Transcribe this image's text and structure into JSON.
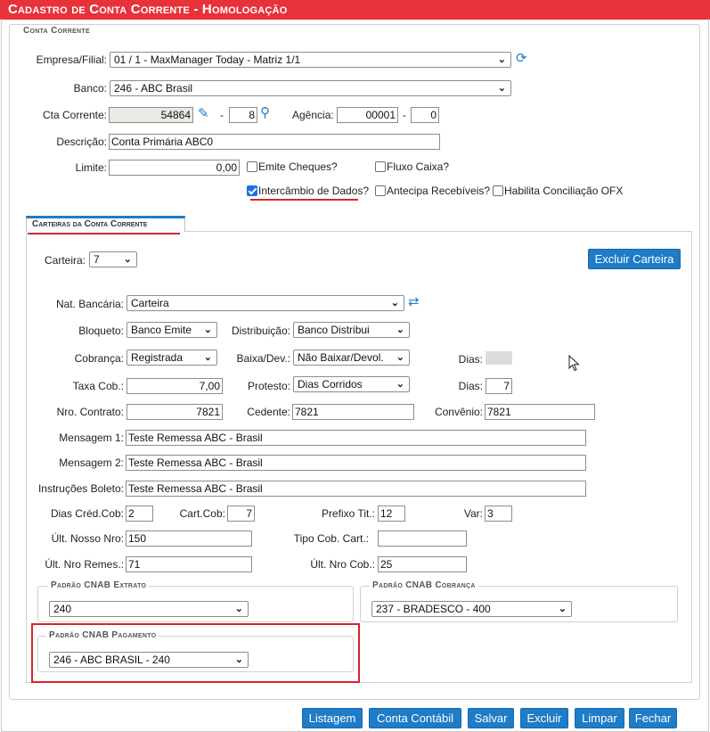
{
  "title": "Cadastro de Conta Corrente  - Homologação",
  "conta_corrente": {
    "legend": "Conta Corrente",
    "empresa_label": "Empresa/Filial:",
    "empresa_value": "01 / 1 - MaxManager Today - Matriz 1/1",
    "banco_label": "Banco:",
    "banco_value": "246 - ABC Brasil",
    "cta_label": "Cta Corrente:",
    "cta_value": "54864",
    "dash": "-",
    "cta_digit": "8",
    "agencia_label": "Agência:",
    "agencia_value": "00001",
    "agencia_digit": "0",
    "descricao_label": "Descrição:",
    "descricao_value": "Conta Primária ABC0",
    "limite_label": "Limite:",
    "limite_value": "0,00",
    "emite_cheques": "Emite Cheques?",
    "fluxo_caixa": "Fluxo Caixa?",
    "intercambio": "Intercâmbio de Dados?",
    "antecipa": "Antecipa Recebíveis?",
    "habilita_ofx": "Habilita Conciliação OFX"
  },
  "tabs": [
    {
      "label": "Carteiras da Conta Corrente"
    }
  ],
  "carteira": {
    "carteira_label": "Carteira:",
    "carteira_value": "7",
    "excluir_carteira": "Excluir Carteira",
    "nat_label": "Nat. Bancária:",
    "nat_value": "Carteira",
    "bloqueto_label": "Bloqueto:",
    "bloqueto_value": "Banco Emite",
    "distribuicao_label": "Distribuição:",
    "distribuicao_value": "Banco Distribui",
    "cobranca_label": "Cobrança:",
    "cobranca_value": "Registrada",
    "baixa_label": "Baixa/Dev.:",
    "baixa_value": "Não Baixar/Devol.",
    "dias1_label": "Dias:",
    "taxa_label": "Taxa Cob.:",
    "taxa_value": "7,00",
    "protesto_label": "Protesto:",
    "protesto_value": "Dias Corridos",
    "dias2_label": "Dias:",
    "dias2_value": "7",
    "contrato_label": "Nro. Contrato:",
    "contrato_value": "7821",
    "cedente_label": "Cedente:",
    "cedente_value": "7821",
    "convenio_label": "Convênio:",
    "convenio_value": "7821",
    "msg1_label": "Mensagem 1:",
    "msg1_value": "Teste Remessa ABC - Brasil",
    "msg2_label": "Mensagem 2:",
    "msg2_value": "Teste Remessa ABC - Brasil",
    "instr_label": "Instruções Boleto:",
    "instr_value": "Teste Remessa ABC - Brasil",
    "dias_cred_label": "Dias Créd.Cob:",
    "dias_cred_value": "2",
    "cart_cob_label": "Cart.Cob:",
    "cart_cob_value": "7",
    "prefixo_label": "Prefixo Tit.:",
    "prefixo_value": "12",
    "var_label": "Var:",
    "var_value": "3",
    "nosso_label": "Últ. Nosso Nro:",
    "nosso_value": "150",
    "tipo_cob_label": "Tipo Cob. Cart.:",
    "tipo_cob_value": "",
    "remes_label": "Últ. Nro Remes.:",
    "remes_value": "71",
    "nro_cob_label": "Últ. Nro Cob.:",
    "nro_cob_value": "25"
  },
  "cnab": {
    "extrato_legend": "Padrão CNAB Extrato",
    "extrato_value": "240",
    "cobranca_legend": "Padrão CNAB Cobrança",
    "cobranca_value": "237 - BRADESCO - 400",
    "pagamento_legend": "Padrão CNAB Pagamento",
    "pagamento_value": "246 - ABC BRASIL - 240"
  },
  "footer_buttons": [
    "Listagem",
    "Conta Contábil",
    "Salvar",
    "Excluir",
    "Limpar",
    "Fechar"
  ],
  "icons": {
    "refresh": "refresh-icon",
    "edit": "pencil-icon",
    "search": "search-icon",
    "dropdown": "chevron-down-icon",
    "cursor": "mouse-pointer-icon"
  },
  "colors": {
    "title_bar": "#e8323a",
    "accent": "#1f7cc7",
    "highlight": "#d9232b"
  }
}
